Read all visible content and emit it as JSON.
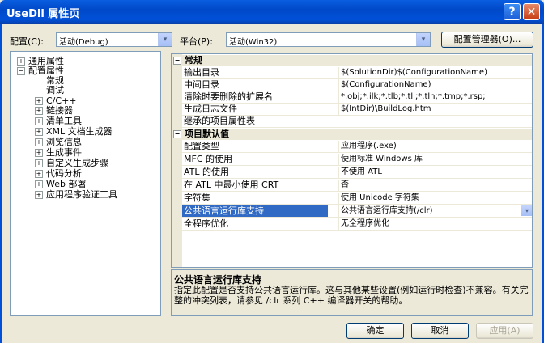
{
  "window": {
    "title": "UseDll 属性页",
    "help_glyph": "?",
    "close_glyph": "✕"
  },
  "toolbar": {
    "config_label": "配置(C):",
    "config_value": "活动(Debug)",
    "platform_label": "平台(P):",
    "platform_value": "活动(Win32)",
    "config_manager_label": "配置管理器(O)..."
  },
  "tree": {
    "items": [
      {
        "label": "通用属性",
        "expander": "+"
      },
      {
        "label": "配置属性",
        "expander": "−"
      },
      {
        "label": "常规"
      },
      {
        "label": "调试"
      },
      {
        "label": "C/C++",
        "expander": "+"
      },
      {
        "label": "链接器",
        "expander": "+"
      },
      {
        "label": "清单工具",
        "expander": "+"
      },
      {
        "label": "XML 文档生成器",
        "expander": "+"
      },
      {
        "label": "浏览信息",
        "expander": "+"
      },
      {
        "label": "生成事件",
        "expander": "+"
      },
      {
        "label": "自定义生成步骤",
        "expander": "+"
      },
      {
        "label": "代码分析",
        "expander": "+"
      },
      {
        "label": "Web 部署",
        "expander": "+"
      },
      {
        "label": "应用程序验证工具",
        "expander": "+"
      }
    ]
  },
  "grid": {
    "categories": [
      {
        "name": "常规",
        "expander": "−"
      },
      {
        "name": "项目默认值",
        "expander": "−"
      }
    ],
    "general_rows": [
      {
        "name": "输出目录",
        "value": "$(SolutionDir)$(ConfigurationName)"
      },
      {
        "name": "中间目录",
        "value": "$(ConfigurationName)"
      },
      {
        "name": "清除时要删除的扩展名",
        "value": "*.obj;*.ilk;*.tlb;*.tli;*.tlh;*.tmp;*.rsp;"
      },
      {
        "name": "生成日志文件",
        "value": "$(IntDir)\\BuildLog.htm"
      },
      {
        "name": "继承的项目属性表",
        "value": ""
      }
    ],
    "default_rows": [
      {
        "name": "配置类型",
        "value": "应用程序(.exe)"
      },
      {
        "name": "MFC 的使用",
        "value": "使用标准 Windows 库"
      },
      {
        "name": "ATL 的使用",
        "value": "不使用 ATL"
      },
      {
        "name": "在 ATL 中最小使用 CRT",
        "value": "否"
      },
      {
        "name": "字符集",
        "value": "使用 Unicode 字符集"
      },
      {
        "name": "公共语言运行库支持",
        "value": "公共语言运行库支持(/clr)"
      },
      {
        "name": "全程序优化",
        "value": "无全程序优化"
      }
    ]
  },
  "description": {
    "title": "公共语言运行库支持",
    "text": "指定此配置是否支持公共语言运行库。这与其他某些设置(例如运行时检查)不兼容。有关完整的冲突列表，请参见 /clr 系列 C++ 编译器开关的帮助。"
  },
  "buttons": {
    "ok": "确定",
    "cancel": "取消",
    "apply": "应用(A)"
  },
  "icons": {
    "dropdown": "▾"
  },
  "colors": {
    "title_bar": "#0050d8",
    "selection": "#316ac5",
    "dialog_bg": "#ece9d8"
  }
}
